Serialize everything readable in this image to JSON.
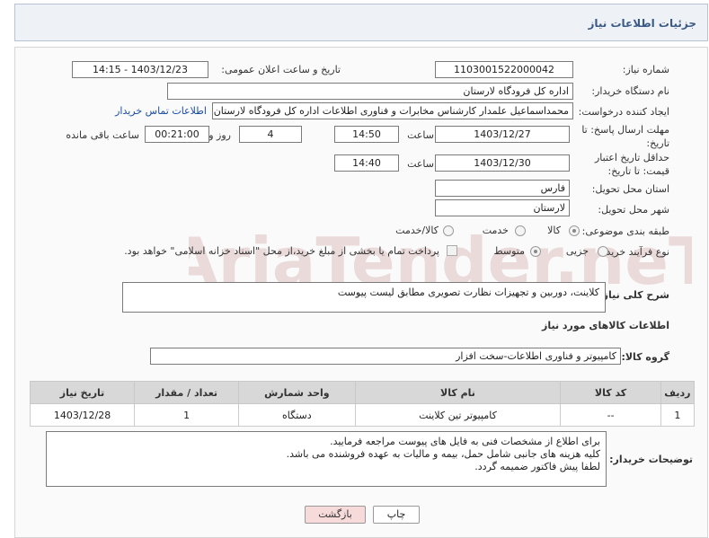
{
  "header": {
    "title": "جزئیات اطلاعات نیاز"
  },
  "form": {
    "need_number": {
      "label": "شماره نیاز:",
      "value": "1103001522000042"
    },
    "announce": {
      "label": "تاریخ و ساعت اعلان عمومی:",
      "value": "1403/12/23 - 14:15"
    },
    "buyer_org": {
      "label": "نام دستگاه خریدار:",
      "value": "اداره کل فرودگاه لارستان"
    },
    "creator": {
      "label": "ایجاد کننده درخواست:",
      "value": "محمداسماعیل علمدار کارشناس مخابرات و فناوری اطلاعات اداره کل فرودگاه لارستان",
      "contact_link": "اطلاعات تماس خریدار"
    },
    "reply_deadline": {
      "label": "مهلت ارسال پاسخ: تا تاریخ:",
      "date": "1403/12/27",
      "time_label": "ساعت",
      "time": "14:50",
      "days": "4",
      "days_label": "روز و",
      "remaining": "00:21:00",
      "remaining_label": "ساعت باقی مانده"
    },
    "price_validity": {
      "label": "حداقل تاریخ اعتبار قیمت: تا تاریخ:",
      "date": "1403/12/30",
      "time_label": "ساعت",
      "time": "14:40"
    },
    "province": {
      "label": "استان محل تحویل:",
      "value": "فارس"
    },
    "city": {
      "label": "شهر محل تحویل:",
      "value": "لارستان"
    },
    "category": {
      "label": "طبقه بندی موضوعی:",
      "options": [
        "کالا",
        "خدمت",
        "کالا/خدمت"
      ],
      "selected": "کالا"
    },
    "process_type": {
      "label": "نوع فرآیند خرید :",
      "options": [
        "جزیی",
        "متوسط"
      ],
      "selected": "متوسط",
      "note": "پرداخت تمام یا بخشی از مبلغ خرید،از محل \"اسناد خزانه اسلامی\" خواهد بود."
    }
  },
  "summary": {
    "label": "شرح کلی نیاز:",
    "value": "کلاینت، دوربین و تجهیزات نظارت تصویری مطابق لیست پیوست"
  },
  "goods_section": {
    "title": "اطلاعات کالاهای مورد نیاز",
    "group_label": "گروه کالا:",
    "group_value": "کامپیوتر و فناوری اطلاعات-سخت افزار"
  },
  "table": {
    "headers": [
      "ردیف",
      "کد کالا",
      "نام کالا",
      "واحد شمارش",
      "تعداد / مقدار",
      "تاریخ نیاز"
    ],
    "rows": [
      [
        "1",
        "--",
        "کامپیوتر تین کلاینت",
        "دستگاه",
        "1",
        "1403/12/28"
      ]
    ]
  },
  "buyer_notes": {
    "label": "توضیحات خریدار:",
    "lines": [
      "برای اطلاع از مشخصات فنی به فایل های پیوست مراجعه فرمایید.",
      "کلیه هزینه های جانبی شامل حمل، بیمه و مالیات به عهده فروشنده می باشد.",
      "لطفا پیش فاکتور ضمیمه گردد."
    ]
  },
  "buttons": {
    "print": "چاپ",
    "back": "بازگشت"
  },
  "watermark": "AriaTender.neT",
  "colors": {
    "header_text": "#3a5a86",
    "link": "#1a4ea3",
    "back_button_bg": "#f7dada"
  }
}
